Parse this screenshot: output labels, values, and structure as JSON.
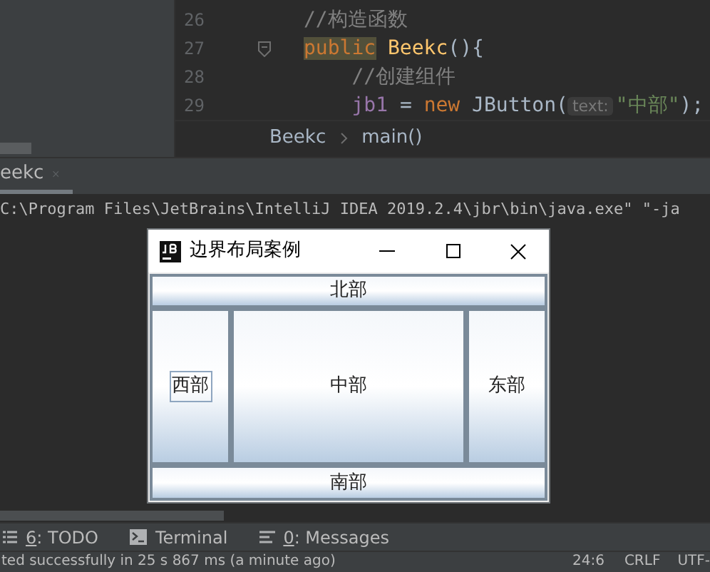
{
  "editor": {
    "lines": [
      {
        "number": "26",
        "fold": false,
        "tokens": [
          {
            "text": "//构造函数",
            "kind": "comment"
          }
        ]
      },
      {
        "number": "27",
        "fold": true,
        "tokens": [
          {
            "text": "public",
            "kind": "keyword-hl"
          },
          {
            "text": " Beekc",
            "kind": "method"
          },
          {
            "text": "(){",
            "kind": "plain"
          }
        ]
      },
      {
        "number": "28",
        "fold": false,
        "tokens": [
          {
            "text": "    //创建组件",
            "kind": "comment"
          }
        ]
      },
      {
        "number": "29",
        "fold": false,
        "tokens": [
          {
            "text": "    jb1",
            "kind": "field"
          },
          {
            "text": " = ",
            "kind": "plain"
          },
          {
            "text": "new",
            "kind": "keyword"
          },
          {
            "text": " JButton(",
            "kind": "plain"
          },
          {
            "text": "text:",
            "kind": "hint"
          },
          {
            "text": "\"中部\"",
            "kind": "string"
          },
          {
            "text": ");",
            "kind": "plain"
          }
        ]
      }
    ],
    "breadcrumbs": [
      "Beekc",
      "main()"
    ]
  },
  "run_tabs": [
    {
      "label": "eekc",
      "selected": true
    }
  ],
  "console": {
    "lines": [
      "C:\\Program Files\\JetBrains\\IntelliJ IDEA 2019.2.4\\jbr\\bin\\java.exe\" \"-ja"
    ]
  },
  "app_window": {
    "title": "边界布局案例",
    "buttons": [
      {
        "kind": "north",
        "label": "北部",
        "focused": false
      },
      {
        "kind": "west",
        "label": "西部",
        "focused": true
      },
      {
        "kind": "center",
        "label": "中部",
        "focused": false
      },
      {
        "kind": "east",
        "label": "东部",
        "focused": false
      },
      {
        "kind": "south",
        "label": "南部",
        "focused": false
      }
    ]
  },
  "tool_tabs": [
    {
      "kind": "todo",
      "label": "6: TODO",
      "mnemonic": true
    },
    {
      "kind": "terminal",
      "label": "Terminal",
      "mnemonic": false
    },
    {
      "kind": "messages",
      "label": "0: Messages",
      "mnemonic": true
    }
  ],
  "status_bar": {
    "message": "ted successfully in 25 s 867 ms (a minute ago)",
    "position": "24:6",
    "line_separator": "CRLF",
    "encoding": "UTF-"
  }
}
